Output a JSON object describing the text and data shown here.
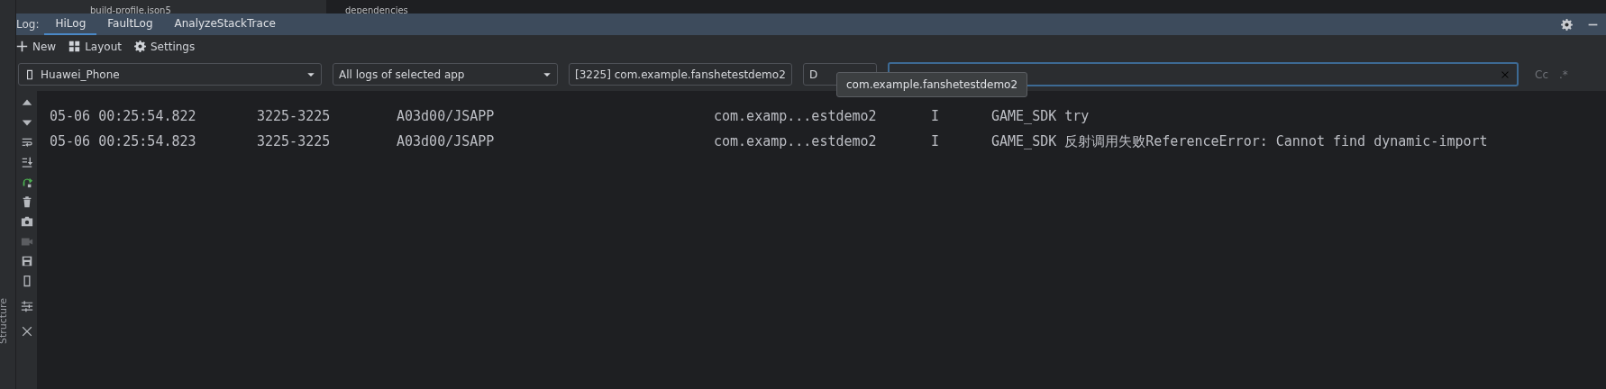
{
  "background_editor": {
    "file_item": "build-profile.json5",
    "code_text": "dependencies"
  },
  "side_strip": {
    "label": "Structure"
  },
  "log_window": {
    "label": "Log:",
    "tabs": [
      {
        "label": "HiLog",
        "selected": true
      },
      {
        "label": "FaultLog",
        "selected": false
      },
      {
        "label": "AnalyzeStackTrace",
        "selected": false
      }
    ],
    "toolbar": [
      {
        "kind": "new",
        "label": "New"
      },
      {
        "kind": "layout",
        "label": "Layout"
      },
      {
        "kind": "settings",
        "label": "Settings"
      }
    ],
    "filters": {
      "device": "Huawei_Phone",
      "scope": "All logs of selected app",
      "process": "[3225] com.example.fanshetestdemo2",
      "level": "D"
    },
    "tooltip": "com.example.fanshetestdemo2",
    "search_options": [
      "Cc",
      ".*"
    ],
    "side_tools": [
      {
        "kind": "up",
        "disabled": false
      },
      {
        "kind": "down",
        "disabled": false
      },
      {
        "kind": "wrap",
        "disabled": false
      },
      {
        "kind": "scroll-end",
        "disabled": false
      },
      {
        "kind": "restart",
        "disabled": false
      },
      {
        "kind": "clear",
        "disabled": false
      },
      {
        "kind": "screenshot",
        "disabled": false
      },
      {
        "kind": "record",
        "disabled": true
      },
      {
        "kind": "save",
        "disabled": false
      },
      {
        "kind": "device",
        "disabled": false
      },
      {
        "kind": "filters",
        "disabled": false
      },
      {
        "kind": "close",
        "disabled": false
      }
    ],
    "rows": [
      {
        "time": "05-06 00:25:54.822",
        "pid": "3225-3225",
        "tag": "A03d00/JSAPP",
        "package": "com.examp...estdemo2",
        "level": "I",
        "message": "GAME_SDK try"
      },
      {
        "time": "05-06 00:25:54.823",
        "pid": "3225-3225",
        "tag": "A03d00/JSAPP",
        "package": "com.examp...estdemo2",
        "level": "I",
        "message": "GAME_SDK 反射调用失败ReferenceError: Cannot find dynamic-import"
      }
    ]
  }
}
